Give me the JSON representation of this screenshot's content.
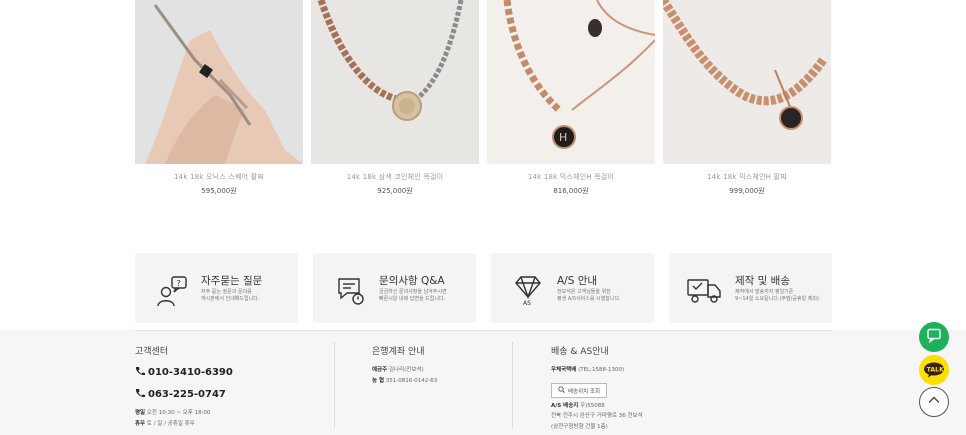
{
  "products": [
    {
      "name": "14k 18k 오닉스 스퀘어 팔찌",
      "price": "595,000원"
    },
    {
      "name": "14k 18k 삼색 코인체인 목걸이",
      "price": "925,000원"
    },
    {
      "name": "14k 18k 믹스체인H 목걸이",
      "price": "816,000원"
    },
    {
      "name": "14k 18k 믹스체인H 팔찌",
      "price": "999,000원"
    }
  ],
  "cards": [
    {
      "title": "자주묻는 질문",
      "desc1": "자주 묻는 질문과 문의를",
      "desc2": "게시판에서 안내해드립니다.",
      "icon": "faq-person-icon"
    },
    {
      "title": "문의사항 Q&A",
      "desc1": "궁금하신 문의사항을 남겨주시면",
      "desc2": "빠른시일 내에 답변을 드립니다.",
      "icon": "qa-chat-icon"
    },
    {
      "title": "A/S 안내",
      "desc1": "전보석은 고객님들을 위한",
      "desc2": "평생 A/S서비스를 시행합니다.",
      "icon": "diamond-icon"
    },
    {
      "title": "제작 및 배송",
      "desc1": "제작에서 발송까지 평일기준",
      "desc2": "9~14일 소요됩니다.(주말/공휴일 제외)",
      "icon": "delivery-truck-icon"
    }
  ],
  "footer": {
    "cs_title": "고객센터",
    "phone1": "010-3410-6390",
    "phone2": "063-225-0747",
    "hours_label": "평일",
    "hours_value": "오전 10:30 ~ 오후 18:00",
    "closed_label": "휴무",
    "closed_value": "토 / 일 / 공휴일 휴무",
    "bank_title": "은행계좌 안내",
    "bank_holder_label": "예금주",
    "bank_holder_value": "김나리(전보석)",
    "bank_account_label": "농 협",
    "bank_account_value": "351-0816-0142-63",
    "ship_title": "배송 & AS안내",
    "courier_label": "우체국택배",
    "courier_value": "(TEL:1588-1300)",
    "track_button": "배송위치 조회",
    "as_label": "A/S 배송지",
    "as_zip": "우)55088",
    "as_addr1": "전북 전주시 완산구 거마평로 36 전보석",
    "as_addr2": "(삼천구청방향 건물 1층)"
  },
  "colors": {
    "chat": "#1fb15a",
    "kakao": "#f9e000",
    "card_bg": "#f4f4f4",
    "footer_bg": "#f6f6f6"
  },
  "floating": {
    "kakao_label": "TALK"
  }
}
